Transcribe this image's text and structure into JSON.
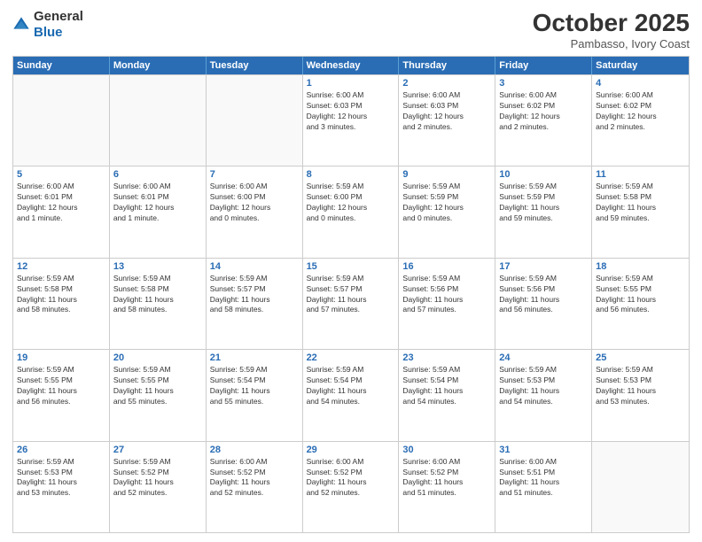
{
  "header": {
    "logo_general": "General",
    "logo_blue": "Blue",
    "month": "October 2025",
    "location": "Pambasso, Ivory Coast"
  },
  "weekdays": [
    "Sunday",
    "Monday",
    "Tuesday",
    "Wednesday",
    "Thursday",
    "Friday",
    "Saturday"
  ],
  "rows": [
    [
      {
        "day": "",
        "info": ""
      },
      {
        "day": "",
        "info": ""
      },
      {
        "day": "",
        "info": ""
      },
      {
        "day": "1",
        "info": "Sunrise: 6:00 AM\nSunset: 6:03 PM\nDaylight: 12 hours\nand 3 minutes."
      },
      {
        "day": "2",
        "info": "Sunrise: 6:00 AM\nSunset: 6:03 PM\nDaylight: 12 hours\nand 2 minutes."
      },
      {
        "day": "3",
        "info": "Sunrise: 6:00 AM\nSunset: 6:02 PM\nDaylight: 12 hours\nand 2 minutes."
      },
      {
        "day": "4",
        "info": "Sunrise: 6:00 AM\nSunset: 6:02 PM\nDaylight: 12 hours\nand 2 minutes."
      }
    ],
    [
      {
        "day": "5",
        "info": "Sunrise: 6:00 AM\nSunset: 6:01 PM\nDaylight: 12 hours\nand 1 minute."
      },
      {
        "day": "6",
        "info": "Sunrise: 6:00 AM\nSunset: 6:01 PM\nDaylight: 12 hours\nand 1 minute."
      },
      {
        "day": "7",
        "info": "Sunrise: 6:00 AM\nSunset: 6:00 PM\nDaylight: 12 hours\nand 0 minutes."
      },
      {
        "day": "8",
        "info": "Sunrise: 5:59 AM\nSunset: 6:00 PM\nDaylight: 12 hours\nand 0 minutes."
      },
      {
        "day": "9",
        "info": "Sunrise: 5:59 AM\nSunset: 5:59 PM\nDaylight: 12 hours\nand 0 minutes."
      },
      {
        "day": "10",
        "info": "Sunrise: 5:59 AM\nSunset: 5:59 PM\nDaylight: 11 hours\nand 59 minutes."
      },
      {
        "day": "11",
        "info": "Sunrise: 5:59 AM\nSunset: 5:58 PM\nDaylight: 11 hours\nand 59 minutes."
      }
    ],
    [
      {
        "day": "12",
        "info": "Sunrise: 5:59 AM\nSunset: 5:58 PM\nDaylight: 11 hours\nand 58 minutes."
      },
      {
        "day": "13",
        "info": "Sunrise: 5:59 AM\nSunset: 5:58 PM\nDaylight: 11 hours\nand 58 minutes."
      },
      {
        "day": "14",
        "info": "Sunrise: 5:59 AM\nSunset: 5:57 PM\nDaylight: 11 hours\nand 58 minutes."
      },
      {
        "day": "15",
        "info": "Sunrise: 5:59 AM\nSunset: 5:57 PM\nDaylight: 11 hours\nand 57 minutes."
      },
      {
        "day": "16",
        "info": "Sunrise: 5:59 AM\nSunset: 5:56 PM\nDaylight: 11 hours\nand 57 minutes."
      },
      {
        "day": "17",
        "info": "Sunrise: 5:59 AM\nSunset: 5:56 PM\nDaylight: 11 hours\nand 56 minutes."
      },
      {
        "day": "18",
        "info": "Sunrise: 5:59 AM\nSunset: 5:55 PM\nDaylight: 11 hours\nand 56 minutes."
      }
    ],
    [
      {
        "day": "19",
        "info": "Sunrise: 5:59 AM\nSunset: 5:55 PM\nDaylight: 11 hours\nand 56 minutes."
      },
      {
        "day": "20",
        "info": "Sunrise: 5:59 AM\nSunset: 5:55 PM\nDaylight: 11 hours\nand 55 minutes."
      },
      {
        "day": "21",
        "info": "Sunrise: 5:59 AM\nSunset: 5:54 PM\nDaylight: 11 hours\nand 55 minutes."
      },
      {
        "day": "22",
        "info": "Sunrise: 5:59 AM\nSunset: 5:54 PM\nDaylight: 11 hours\nand 54 minutes."
      },
      {
        "day": "23",
        "info": "Sunrise: 5:59 AM\nSunset: 5:54 PM\nDaylight: 11 hours\nand 54 minutes."
      },
      {
        "day": "24",
        "info": "Sunrise: 5:59 AM\nSunset: 5:53 PM\nDaylight: 11 hours\nand 54 minutes."
      },
      {
        "day": "25",
        "info": "Sunrise: 5:59 AM\nSunset: 5:53 PM\nDaylight: 11 hours\nand 53 minutes."
      }
    ],
    [
      {
        "day": "26",
        "info": "Sunrise: 5:59 AM\nSunset: 5:53 PM\nDaylight: 11 hours\nand 53 minutes."
      },
      {
        "day": "27",
        "info": "Sunrise: 5:59 AM\nSunset: 5:52 PM\nDaylight: 11 hours\nand 52 minutes."
      },
      {
        "day": "28",
        "info": "Sunrise: 6:00 AM\nSunset: 5:52 PM\nDaylight: 11 hours\nand 52 minutes."
      },
      {
        "day": "29",
        "info": "Sunrise: 6:00 AM\nSunset: 5:52 PM\nDaylight: 11 hours\nand 52 minutes."
      },
      {
        "day": "30",
        "info": "Sunrise: 6:00 AM\nSunset: 5:52 PM\nDaylight: 11 hours\nand 51 minutes."
      },
      {
        "day": "31",
        "info": "Sunrise: 6:00 AM\nSunset: 5:51 PM\nDaylight: 11 hours\nand 51 minutes."
      },
      {
        "day": "",
        "info": ""
      }
    ]
  ]
}
